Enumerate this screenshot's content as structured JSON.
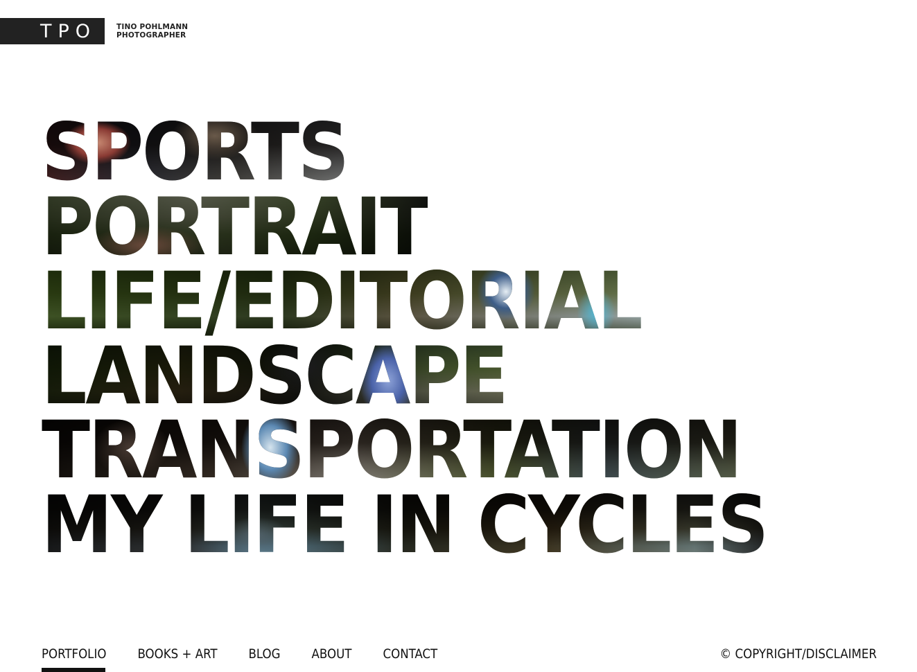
{
  "header": {
    "logo_text": "TPO",
    "name": "TINO POHLMANN",
    "role": "PHOTOGRAPHER"
  },
  "categories": [
    {
      "label": "SPORTS"
    },
    {
      "label": "PORTRAIT"
    },
    {
      "label": "LIFE/EDITORIAL"
    },
    {
      "label": "LANDSCAPE"
    },
    {
      "label": "TRANSPORTATION"
    },
    {
      "label": "MY LIFE IN CYCLES"
    }
  ],
  "footer_nav": {
    "items": [
      {
        "label": "PORTFOLIO",
        "active": true
      },
      {
        "label": "BOOKS + ART",
        "active": false
      },
      {
        "label": "BLOG",
        "active": false
      },
      {
        "label": "ABOUT",
        "active": false
      },
      {
        "label": "CONTACT",
        "active": false
      }
    ],
    "copyright": "© COPYRIGHT/DISCLAIMER"
  },
  "colors": {
    "logo_background": "#222222",
    "text": "#111111",
    "background": "#ffffff"
  }
}
